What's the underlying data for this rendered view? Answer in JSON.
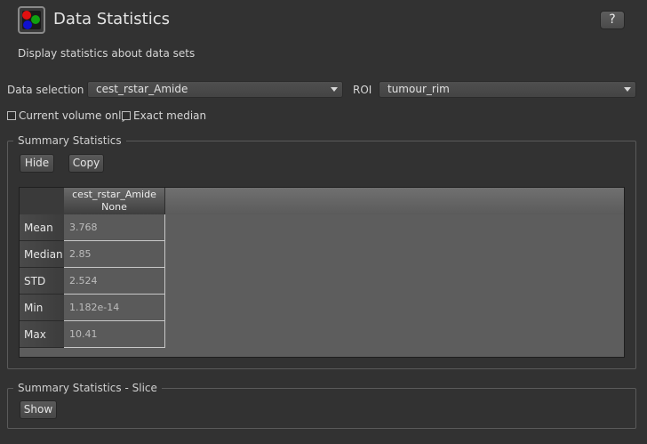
{
  "header": {
    "title": "Data Statistics",
    "help_label": "?",
    "description": "Display statistics about data sets"
  },
  "selection": {
    "data_label": "Data selection",
    "data_value": "cest_rstar_Amide",
    "roi_label": "ROI",
    "roi_value": "tumour_rim"
  },
  "options": {
    "current_volume_label": "Current volume only",
    "current_volume_checked": false,
    "exact_median_label": "Exact median",
    "exact_median_checked": false
  },
  "summary": {
    "title": "Summary Statistics",
    "hide_label": "Hide",
    "copy_label": "Copy",
    "table": {
      "column_header": "cest_rstar_Amide",
      "column_subheader": "None",
      "rows": [
        {
          "label": "Mean",
          "value": "3.768"
        },
        {
          "label": "Median",
          "value": "2.85"
        },
        {
          "label": "STD",
          "value": "2.524"
        },
        {
          "label": "Min",
          "value": "1.182e-14"
        },
        {
          "label": "Max",
          "value": "10.41"
        }
      ]
    }
  },
  "summary_slice": {
    "title": "Summary Statistics - Slice",
    "show_label": "Show"
  },
  "colors": {
    "background": "#323232",
    "icon_red": "#e01010",
    "icon_green": "#10a010",
    "icon_blue": "#1010d0"
  }
}
